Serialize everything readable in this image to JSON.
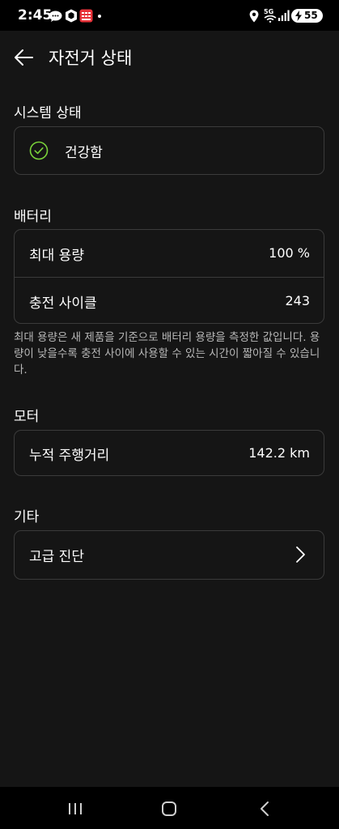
{
  "status_bar": {
    "time": "2:45",
    "network": "5G",
    "battery_level": "55",
    "icons": [
      "chat-bubble-icon",
      "shield-app-icon",
      "calendar-app-icon",
      "location-icon",
      "wifi-5g-icon",
      "signal-icon",
      "battery-charging-icon"
    ]
  },
  "header": {
    "title": "자전거 상태",
    "back_icon": "arrow-left-icon"
  },
  "system_status": {
    "title": "시스템 상태",
    "status": "건강함",
    "icon": "check-circle-icon",
    "accent_color": "#7ad33a"
  },
  "battery": {
    "title": "배터리",
    "rows": [
      {
        "label": "최대 용량",
        "value": "100 %"
      },
      {
        "label": "충전 사이클",
        "value": "243"
      }
    ],
    "note": "최대 용량은 새 제품을 기준으로 배터리 용량을 측정한 값입니다. 용량이 낮을수록 충전 사이에 사용할 수 있는 시간이 짧아질 수 있습니다."
  },
  "motor": {
    "title": "모터",
    "rows": [
      {
        "label": "누적 주행거리",
        "value": "142.2 km"
      }
    ]
  },
  "other": {
    "title": "기타",
    "rows": [
      {
        "label": "고급 진단",
        "icon": "chevron-right-icon"
      }
    ]
  },
  "nav_bar": {
    "icons": [
      "recents-icon",
      "home-icon",
      "back-icon"
    ]
  },
  "colors": {
    "background": "#151515",
    "card_border": "#3b3b3b",
    "text": "#ffffff",
    "secondary_text": "#b8b8b8",
    "success": "#7ad33a"
  }
}
